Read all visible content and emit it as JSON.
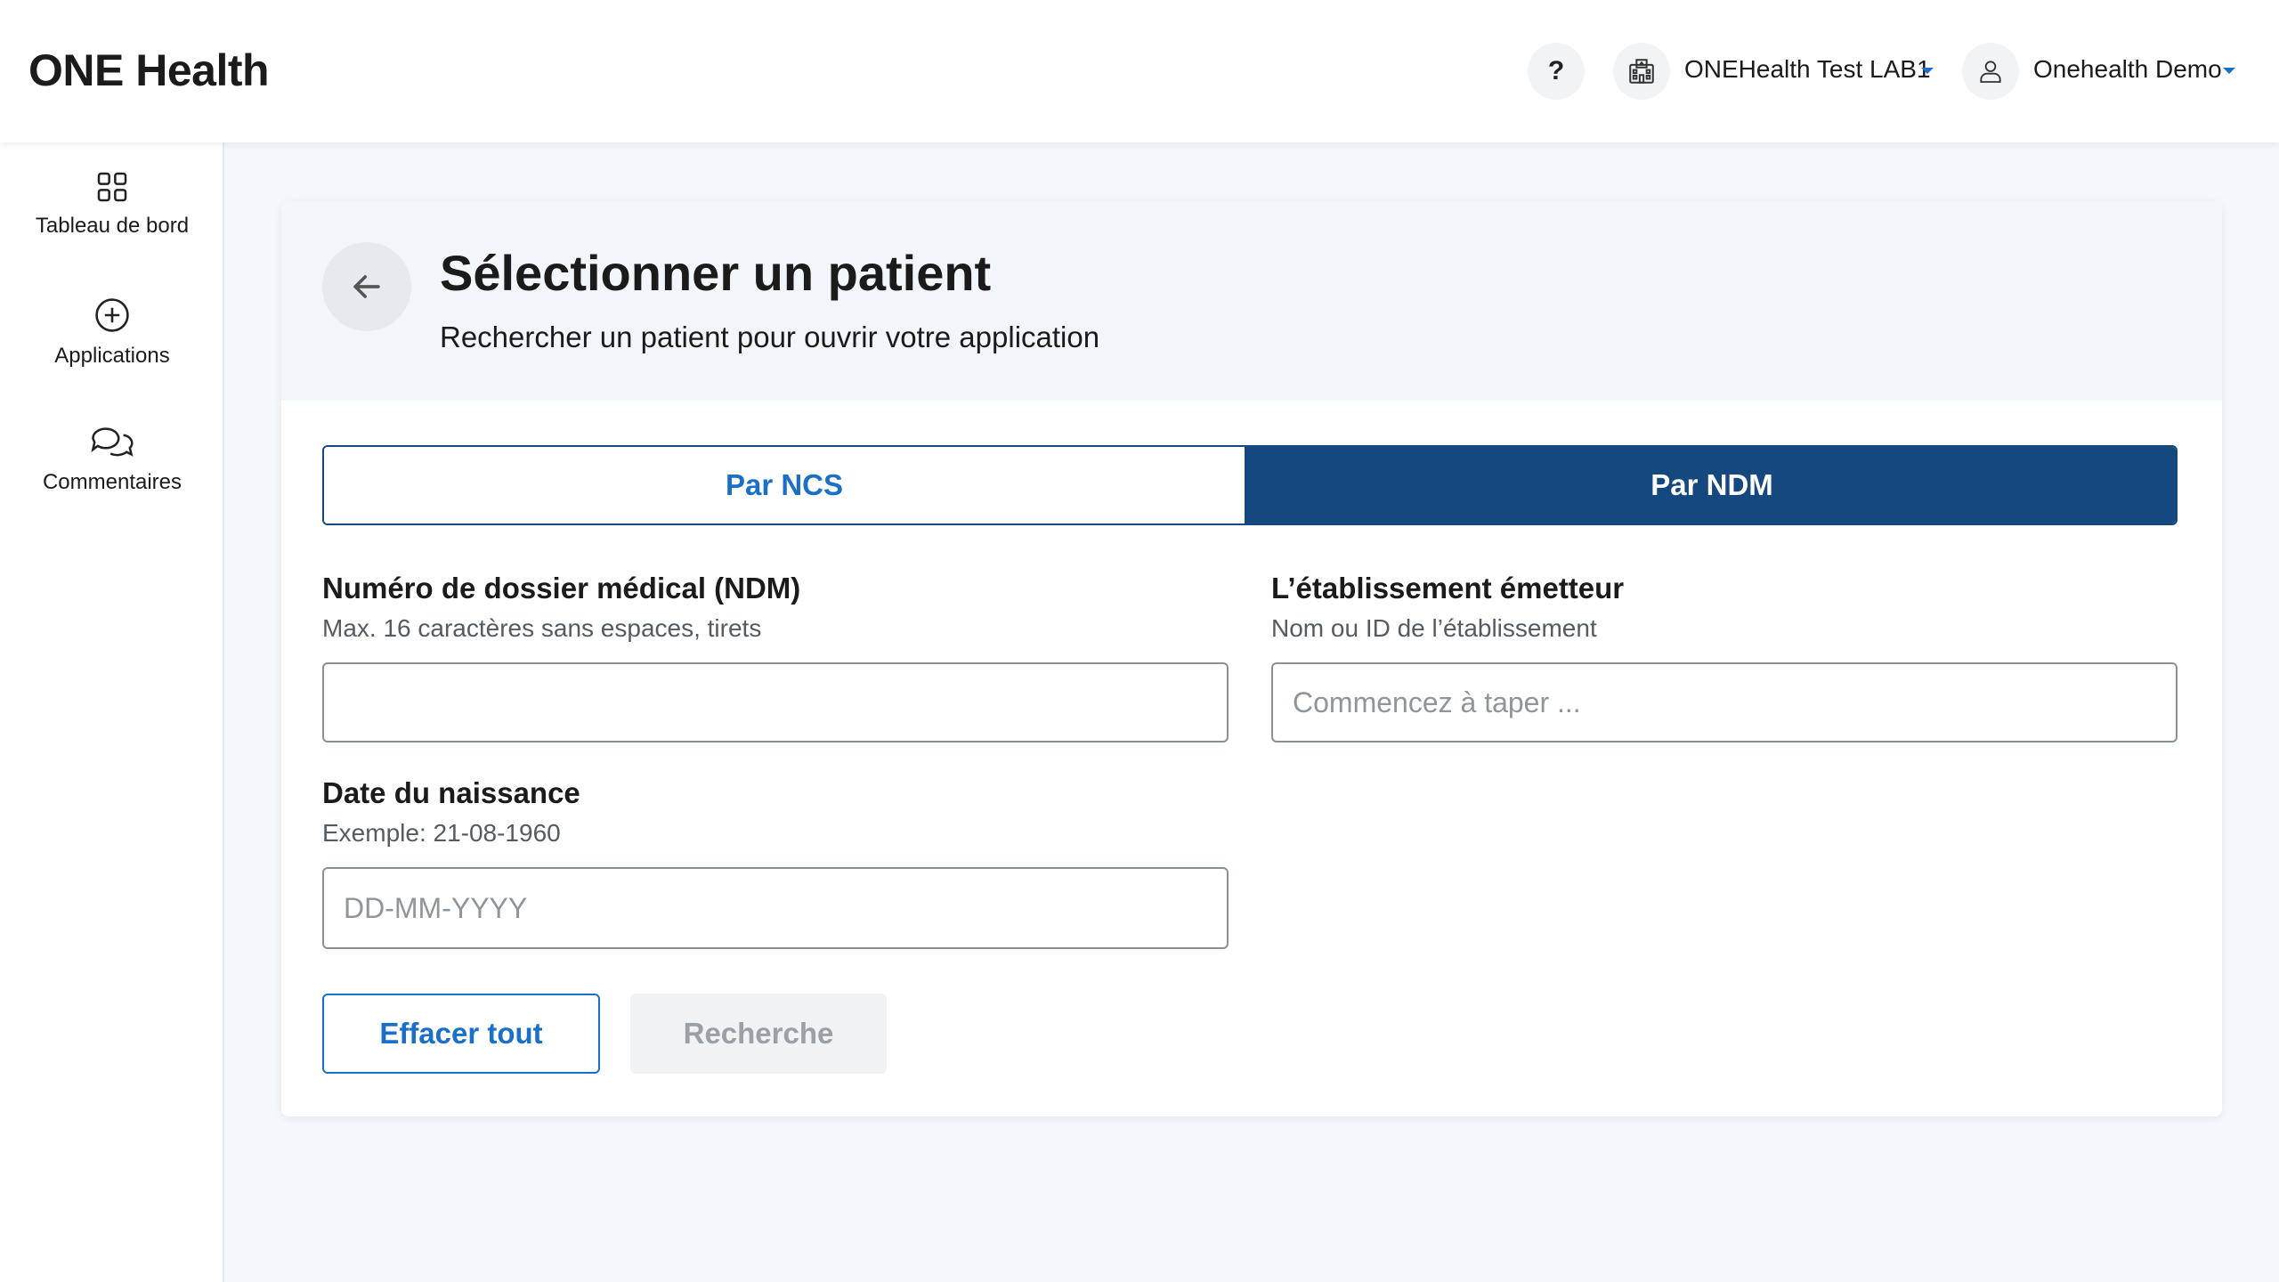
{
  "header": {
    "brand": "ONE Health",
    "help_label": "?",
    "lab": {
      "label": "ONEHealth Test LAB1",
      "icon": "hospital-icon"
    },
    "user": {
      "label": "Onehealth Demo",
      "icon": "user-icon"
    }
  },
  "sidebar": {
    "items": [
      {
        "label": "Tableau de bord",
        "icon": "grid-icon"
      },
      {
        "label": "Applications",
        "icon": "plus-circle-icon"
      },
      {
        "label": "Commentaires",
        "icon": "chat-bubbles-icon"
      }
    ]
  },
  "page": {
    "title": "Sélectionner un patient",
    "subtitle": "Rechercher un patient pour ouvrir votre application"
  },
  "tabs": [
    {
      "label": "Par NCS",
      "active": false
    },
    {
      "label": "Par NDM",
      "active": true
    }
  ],
  "form": {
    "ndm": {
      "label": "Numéro de dossier médical (NDM)",
      "hint": "Max. 16 caractères sans espaces, tirets",
      "value": "",
      "placeholder": ""
    },
    "issuer": {
      "label": "L’établissement émetteur",
      "hint": "Nom ou ID de l’établissement",
      "value": "",
      "placeholder": "Commencez à taper ..."
    },
    "dob": {
      "label": "Date du naissance",
      "hint": "Exemple: 21-08-1960",
      "value": "",
      "placeholder": "DD-MM-YYYY"
    }
  },
  "actions": {
    "clear_label": "Effacer tout",
    "search_label": "Recherche",
    "search_disabled": true
  },
  "colors": {
    "primary": "#14487e",
    "accent": "#1a6fc9",
    "background": "#f3f8fc"
  }
}
